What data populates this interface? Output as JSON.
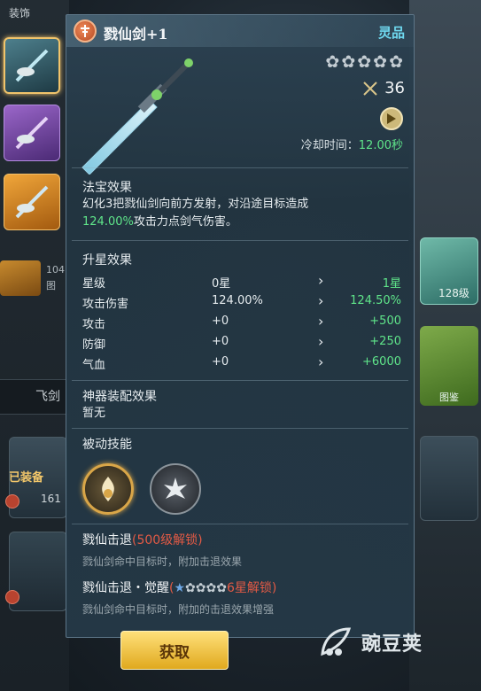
{
  "background": {
    "top_label": "装饰",
    "num_a": "104",
    "num_b": "图",
    "flysword_label": "飞剑",
    "equip_tag": "已装备",
    "equip_num": "161",
    "robe_level": "128级",
    "card_label": "图鉴"
  },
  "header": {
    "title": "戮仙剑+1",
    "grade": "灵品"
  },
  "stats": {
    "star_count": 5,
    "power": "36",
    "cooldown_label": "冷却时间：",
    "cooldown_value": "12.00秒"
  },
  "treasure_effect": {
    "title": "法宝效果",
    "line1": "幻化3把戮仙剑向前方发射，对沿途目标造成",
    "line2_value": "124.00%",
    "line2_rest": "攻击力点剑气伤害。"
  },
  "star_upgrade": {
    "title": "升星效果",
    "rows": [
      {
        "label": "星级",
        "current": "0星",
        "next": "1星"
      },
      {
        "label": "攻击伤害",
        "current": "124.00%",
        "next": "124.50%"
      },
      {
        "label": "攻击",
        "current": "+0",
        "next": "+500"
      },
      {
        "label": "防御",
        "current": "+0",
        "next": "+250"
      },
      {
        "label": "气血",
        "current": "+0",
        "next": "+6000"
      }
    ]
  },
  "artifact": {
    "title": "神器装配效果",
    "value": "暂无"
  },
  "passive": {
    "title": "被动技能",
    "skill1_name": "戮仙击退",
    "skill1_lock": "(500级解锁)",
    "skill1_desc": "戮仙剑命中目标时，附加击退效果",
    "skill2_name": "戮仙击退・觉醒",
    "skill2_open": "(",
    "skill2_lock": "6星解锁)",
    "skill2_desc": "戮仙剑命中目标时，附加的击退效果增强"
  },
  "actions": {
    "get_label": "获取"
  },
  "watermark": {
    "text": "豌豆荚"
  },
  "colors": {
    "grade": "#6fd9f0",
    "highlight_green": "#5fe58a",
    "lock_red": "#e35a45",
    "button_gold": "#e0a91e"
  }
}
